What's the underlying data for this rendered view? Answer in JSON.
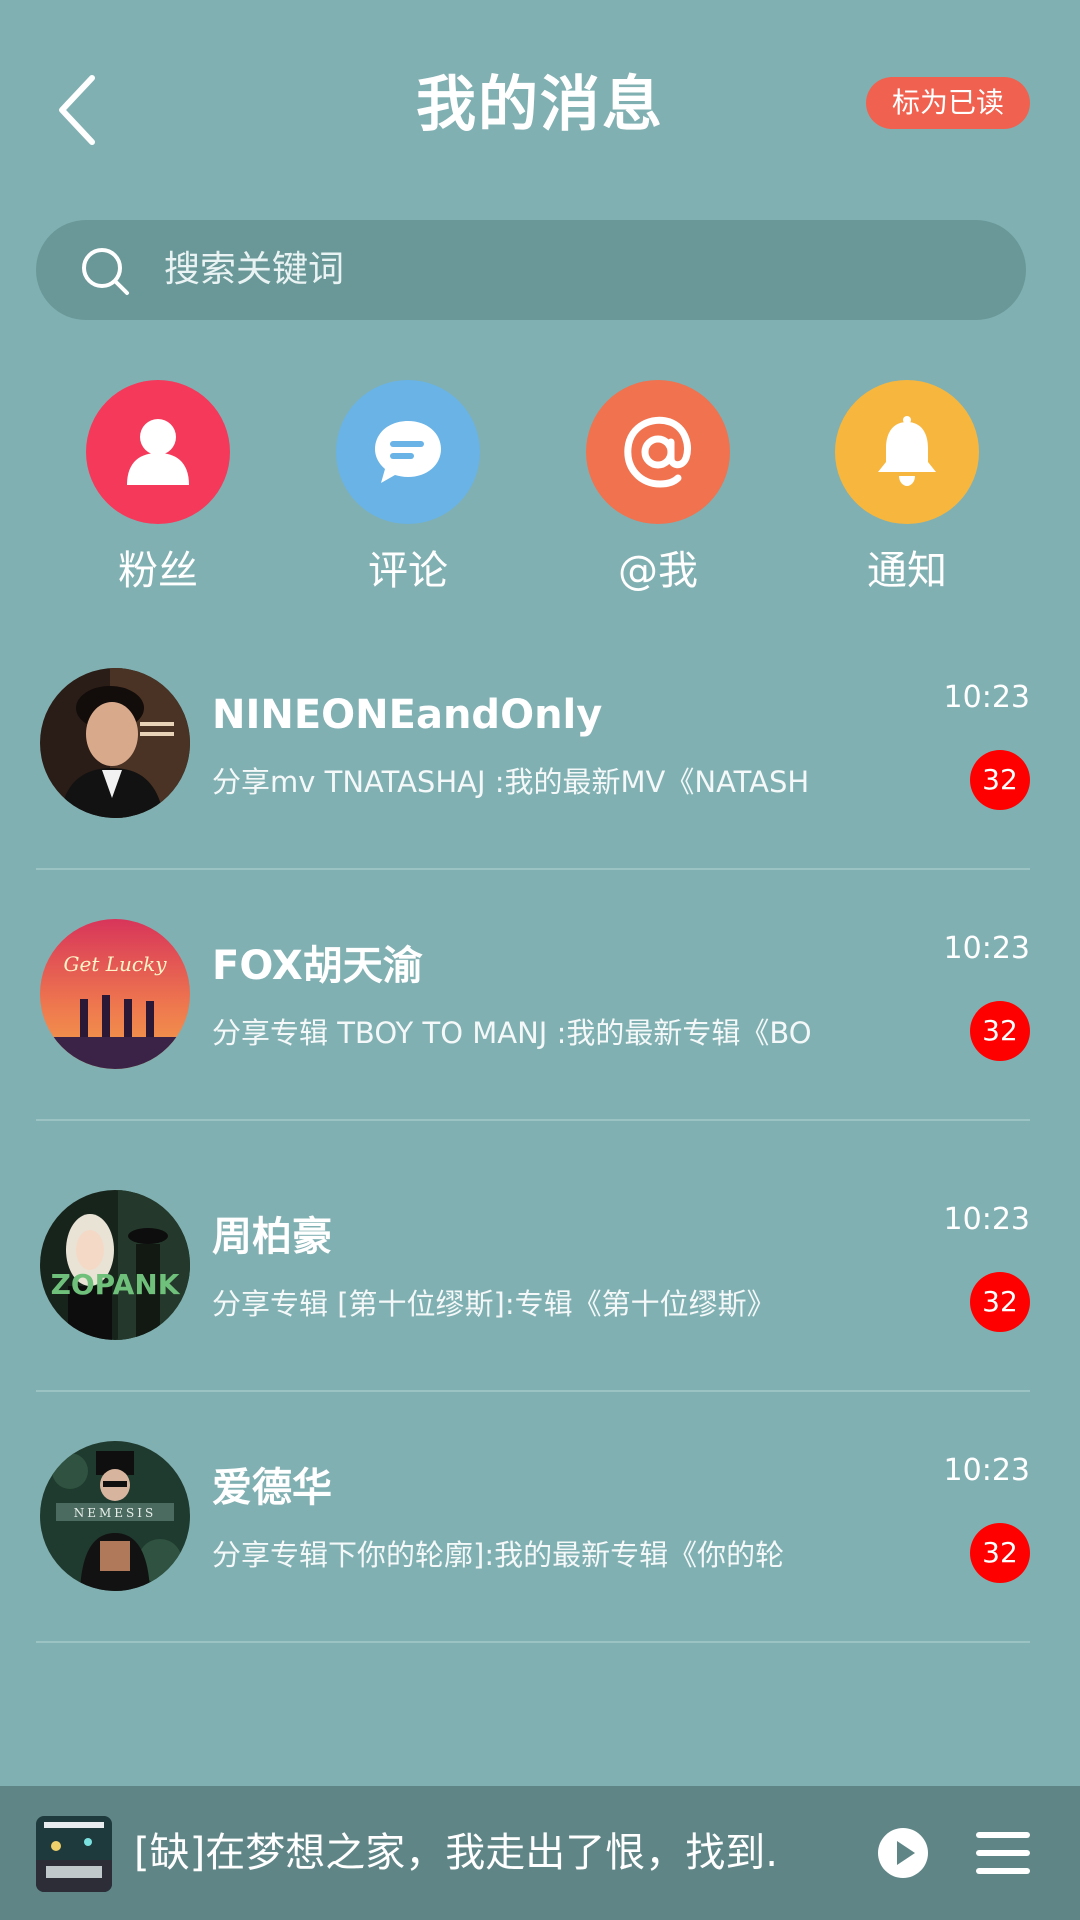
{
  "header": {
    "title": "我的消息",
    "mark_read_label": "标为已读",
    "back_icon": "chevron-left-icon"
  },
  "search": {
    "placeholder": "搜索关键词",
    "icon": "search-icon"
  },
  "categories": [
    {
      "label": "粉丝",
      "icon": "person-icon",
      "color": "#f5395a"
    },
    {
      "label": "评论",
      "icon": "comment-bubble-icon",
      "color": "#69b3e6"
    },
    {
      "label": "@我",
      "icon": "at-sign-icon",
      "color": "#f0724f"
    },
    {
      "label": "通知",
      "icon": "bell-icon",
      "color": "#f7b63e"
    }
  ],
  "messages": [
    {
      "name": "NINEONEandOnly",
      "preview": "分享mv TNATASHAJ :我的最新MV《NATASH",
      "time": "10:23",
      "count": "32"
    },
    {
      "name": "FOX胡天渝",
      "preview": "分享专辑 TBOY TO MANJ :我的最新专辑《BO",
      "time": "10:23",
      "count": "32",
      "avatar_text": "Get Lucky"
    },
    {
      "name": "周柏豪",
      "preview": "分享专辑 [第十位缪斯]:专辑《第十位缪斯》",
      "time": "10:23",
      "count": "32",
      "avatar_text": "ZOPANK"
    },
    {
      "name": "爱德华",
      "preview": "分享专辑下你的轮廓]:我的最新专辑《你的轮",
      "time": "10:23",
      "count": "32",
      "avatar_text": "NEMESIS"
    }
  ],
  "player": {
    "song": "[缺]在梦想之家，我走出了恨，找到..",
    "play_icon": "play-icon",
    "menu_icon": "menu-icon"
  },
  "colors": {
    "background": "#80b0b2",
    "accent": "#f0624f",
    "badge": "#ff0000",
    "player_bar": "#5f8586"
  }
}
